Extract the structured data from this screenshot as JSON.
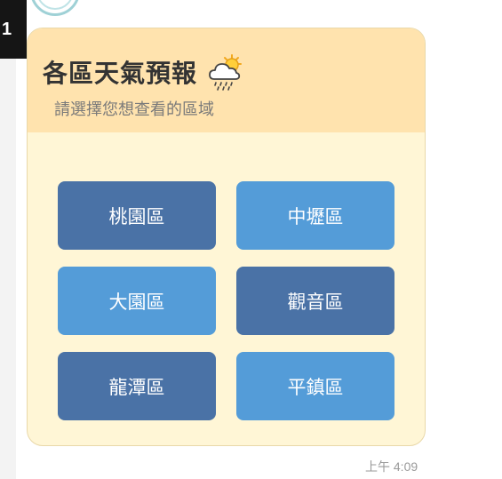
{
  "left_bar": {
    "label": "1"
  },
  "card": {
    "title": "各區天氣預報",
    "subtitle": "請選擇您想查看的區域",
    "buttons": [
      {
        "label": "桃園區",
        "style": "dark"
      },
      {
        "label": "中壢區",
        "style": "light"
      },
      {
        "label": "大園區",
        "style": "light"
      },
      {
        "label": "觀音區",
        "style": "dark"
      },
      {
        "label": "龍潭區",
        "style": "dark"
      },
      {
        "label": "平鎮區",
        "style": "light"
      }
    ]
  },
  "message": {
    "timestamp": "上午 4:09"
  },
  "colors": {
    "header_bg": "#ffe3ae",
    "card_bg": "#fff6d6",
    "button_dark": "#4a72a6",
    "button_light": "#549cd8"
  }
}
